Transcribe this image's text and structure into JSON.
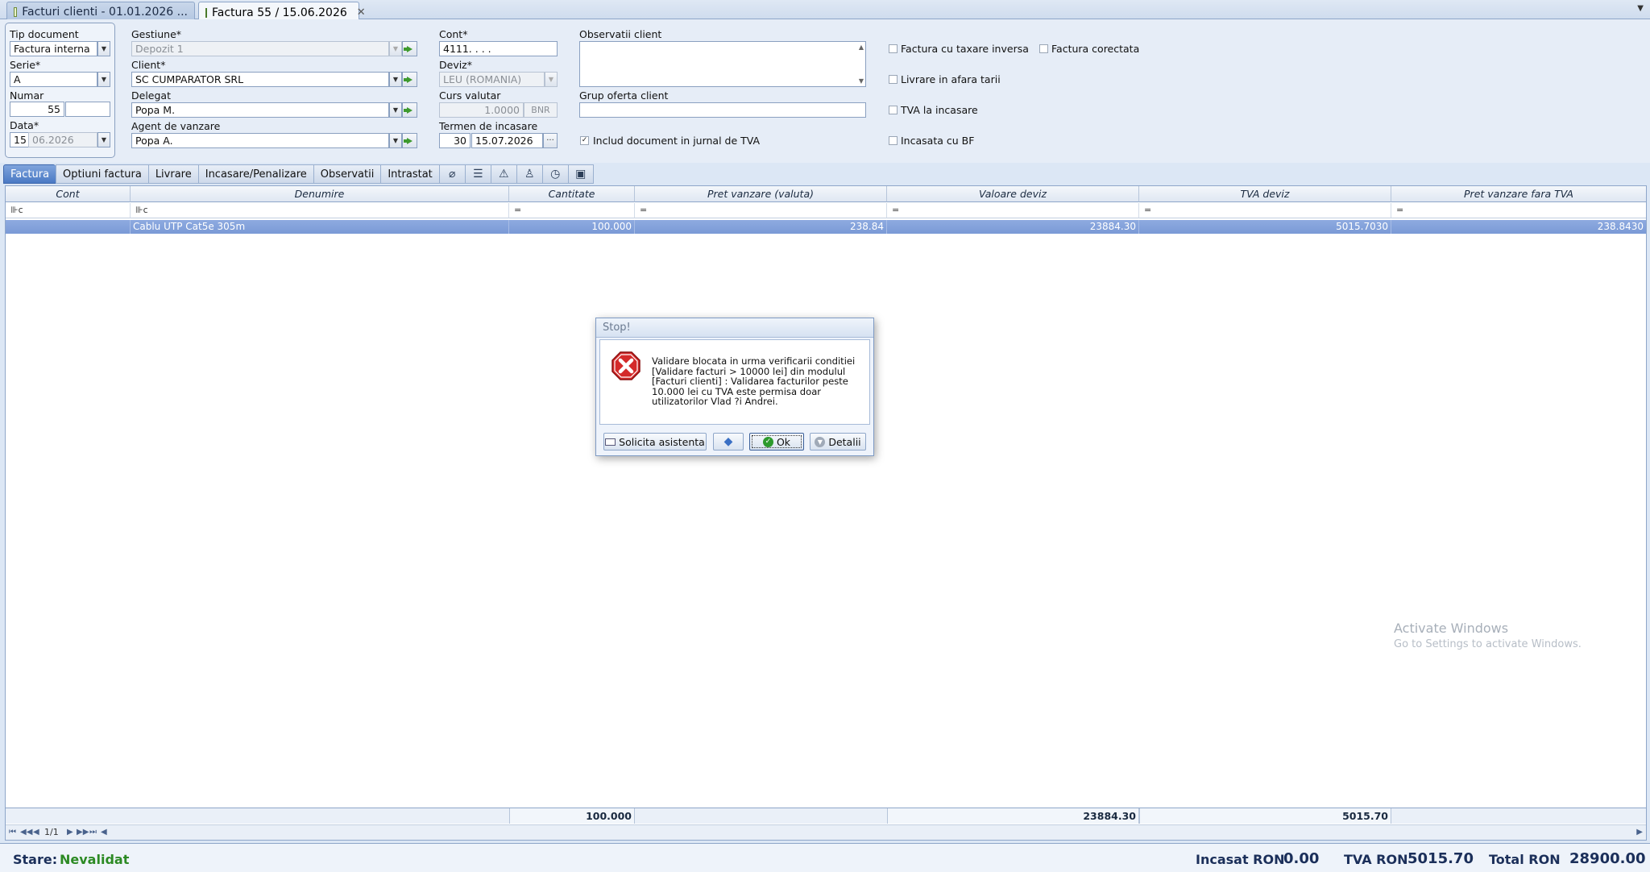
{
  "tabs": [
    {
      "label": "Facturi clienti - 01.01.2026 ..."
    },
    {
      "label": "Factura 55 / 15.06.2026"
    }
  ],
  "form": {
    "tip_document": {
      "label": "Tip document",
      "value": "Factura interna"
    },
    "serie": {
      "label": "Serie*",
      "value": "A"
    },
    "numar": {
      "label": "Numar",
      "value": "55"
    },
    "data": {
      "label": "Data*",
      "day": "15",
      "rest": "06.2026"
    },
    "gestiune": {
      "label": "Gestiune*",
      "value": "Depozit 1"
    },
    "client": {
      "label": "Client*",
      "value": "SC CUMPARATOR SRL"
    },
    "delegat": {
      "label": "Delegat",
      "value": "Popa M."
    },
    "agent": {
      "label": "Agent de vanzare",
      "value": "Popa A."
    },
    "cont": {
      "label": "Cont*",
      "value": "4111. . . ."
    },
    "deviz": {
      "label": "Deviz*",
      "value": "LEU (ROMANIA)"
    },
    "curs": {
      "label": "Curs valutar",
      "value": "1.0000",
      "source": "BNR"
    },
    "termen": {
      "label": "Termen de incasare",
      "days": "30",
      "date": "15.07.2026"
    },
    "jurnal_tva": {
      "label": "Includ document in jurnal de TVA",
      "checked": true
    },
    "observatii": {
      "label": "Observatii client"
    },
    "grup_oferta": {
      "label": "Grup oferta client"
    },
    "checks": {
      "taxare_inversa": "Factura cu taxare inversa",
      "corectata": "Factura corectata",
      "livrare_afara": "Livrare in afara tarii",
      "tva_incasare": "TVA la incasare",
      "incasata_bf": "Incasata cu BF"
    }
  },
  "section_tabs": [
    "Factura",
    "Optiuni factura",
    "Livrare",
    "Incasare/Penalizare",
    "Observatii",
    "Intrastat"
  ],
  "grid": {
    "columns": [
      "Cont",
      "Denumire",
      "Cantitate",
      "Pret vanzare (valuta)",
      "Valoare deviz",
      "TVA deviz",
      "Pret vanzare fara TVA"
    ],
    "rows": [
      {
        "cont": "",
        "denumire": "Cablu UTP Cat5e 305m",
        "cantitate": "100.000",
        "pret": "238.84",
        "valoare": "23884.30",
        "tva": "5015.7030",
        "pret_fara_tva": "238.8430"
      }
    ],
    "totals": {
      "cantitate": "100.000",
      "valoare": "23884.30",
      "tva": "5015.70"
    },
    "pager": "1/1"
  },
  "watermark": {
    "line1": "Activate Windows",
    "line2": "Go to Settings to activate Windows."
  },
  "status": {
    "stare_label": "Stare:",
    "stare_value": "Nevalidat",
    "incasat_label": "Incasat RON",
    "incasat_value": "0.00",
    "tva_label": "TVA RON",
    "tva_value": "5015.70",
    "total_label": "Total RON",
    "total_value": "28900.00"
  },
  "dialog": {
    "title": "Stop!",
    "message_lines": [
      "Validare blocata in urma verificarii conditiei",
      "[Validare facturi > 10000 lei] din modulul",
      "[Facturi clienti] : Validarea facturilor peste",
      "10.000 lei cu TVA este permisa doar",
      "utilizatorilor Vlad ?i Andrei."
    ],
    "buttons": {
      "assist": "Solicita asistenta",
      "ok": "Ok",
      "details": "Detalii"
    }
  },
  "colors": {
    "accent": "#4a79c4",
    "row_selected": "#7a9ad6",
    "status_green": "#2c8a24",
    "error_red": "#d42a2a"
  }
}
